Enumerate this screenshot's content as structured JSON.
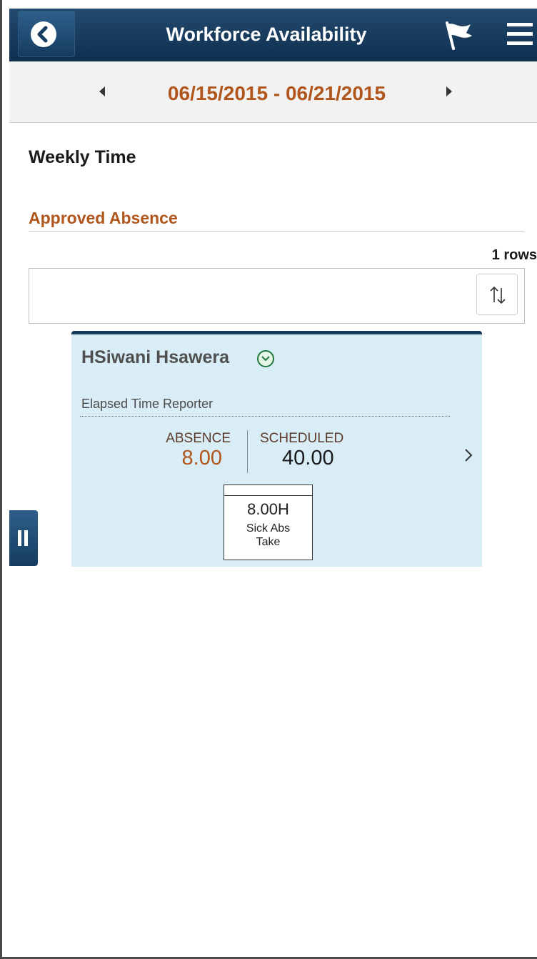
{
  "header": {
    "title": "Workforce Availability",
    "back_icon": "back-arrow-icon",
    "flag_icon": "flag-icon",
    "menu_icon": "hamburger-menu-icon"
  },
  "date_nav": {
    "range": "06/15/2015 - 06/21/2015"
  },
  "page": {
    "section_title": "Weekly Time",
    "group_title": "Approved Absence",
    "row_count": "1 rows"
  },
  "card": {
    "name": "HSiwani Hsawera",
    "role": "Elapsed Time Reporter",
    "absence_label": "ABSENCE",
    "absence_value": "8.00",
    "scheduled_label": "SCHEDULED",
    "scheduled_value": "40.00",
    "tile": {
      "hours": "8.00H",
      "line1": "Sick Abs",
      "line2": "Take"
    }
  },
  "colors": {
    "header_bg": "#1b3f63",
    "accent_orange": "#b0561c",
    "card_bg": "#d9edf7"
  }
}
